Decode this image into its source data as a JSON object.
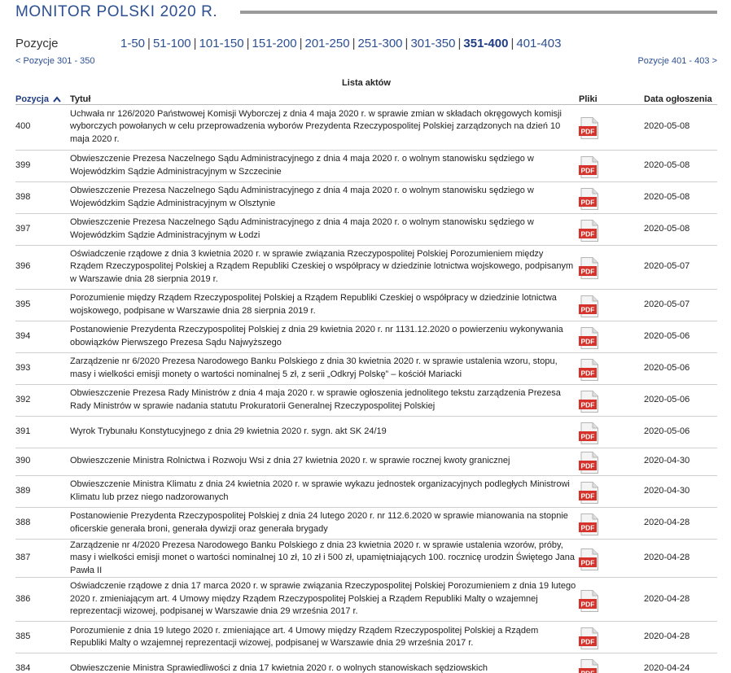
{
  "header": {
    "title": "MONITOR POLSKI 2020 R."
  },
  "pagination": {
    "label": "Pozycje",
    "pages": [
      {
        "label": "1-50",
        "current": false
      },
      {
        "label": "51-100",
        "current": false
      },
      {
        "label": "101-150",
        "current": false
      },
      {
        "label": "151-200",
        "current": false
      },
      {
        "label": "201-250",
        "current": false
      },
      {
        "label": "251-300",
        "current": false
      },
      {
        "label": "301-350",
        "current": false
      },
      {
        "label": "351-400",
        "current": true
      },
      {
        "label": "401-403",
        "current": false
      }
    ],
    "prev": "< Pozycje 301 - 350",
    "next": "Pozycje 401 - 403 >"
  },
  "table": {
    "caption": "Lista aktów",
    "columns": {
      "position": "Pozycja",
      "title": "Tytuł",
      "files": "Pliki",
      "date": "Data ogłoszenia"
    },
    "file_icon": "pdf-icon",
    "file_label": "PDF",
    "rows": [
      {
        "num": "400",
        "title": "Uchwała nr 126/2020 Państwowej Komisji Wyborczej z dnia 4 maja 2020 r. w sprawie zmian w składach okręgowych komisji wyborczych powołanych w celu przeprowadzenia wyborów Prezydenta Rzeczypospolitej Polskiej zarządzonych na dzień 10 maja 2020 r.",
        "date": "2020-05-08"
      },
      {
        "num": "399",
        "title": "Obwieszczenie Prezesa Naczelnego Sądu Administracyjnego z dnia 4 maja 2020 r. o wolnym stanowisku sędziego w Wojewódzkim Sądzie Administracyjnym w Szczecinie",
        "date": "2020-05-08"
      },
      {
        "num": "398",
        "title": "Obwieszczenie Prezesa Naczelnego Sądu Administracyjnego z dnia 4 maja 2020 r. o wolnym stanowisku sędziego w Wojewódzkim Sądzie Administracyjnym w Olsztynie",
        "date": "2020-05-08"
      },
      {
        "num": "397",
        "title": "Obwieszczenie Prezesa Naczelnego Sądu Administracyjnego z dnia 4 maja 2020 r. o wolnym stanowisku sędziego w Wojewódzkim Sądzie Administracyjnym w Łodzi",
        "date": "2020-05-08"
      },
      {
        "num": "396",
        "title": "Oświadczenie rządowe z dnia 3 kwietnia 2020 r. w sprawie związania Rzeczypospolitej Polskiej Porozumieniem między Rządem Rzeczypospolitej Polskiej a Rządem Republiki Czeskiej o współpracy w dziedzinie lotnictwa wojskowego, podpisanym w Warszawie dnia 28 sierpnia 2019 r.",
        "date": "2020-05-07"
      },
      {
        "num": "395",
        "title": "Porozumienie między Rządem Rzeczypospolitej Polskiej a Rządem Republiki Czeskiej o współpracy w dziedzinie lotnictwa wojskowego, podpisane w Warszawie dnia 28 sierpnia 2019 r.",
        "date": "2020-05-07"
      },
      {
        "num": "394",
        "title": "Postanowienie Prezydenta Rzeczypospolitej Polskiej z dnia 29 kwietnia 2020 r. nr 1131.12.2020 o powierzeniu wykonywania obowiązków Pierwszego Prezesa Sądu Najwyższego",
        "date": "2020-05-06"
      },
      {
        "num": "393",
        "title": "Zarządzenie nr 6/2020 Prezesa Narodowego Banku Polskiego z dnia 30 kwietnia 2020 r. w sprawie ustalenia wzoru, stopu, masy i wielkości emisji monety o wartości nominalnej 5 zł, z serii „Odkryj Polskę” – kościół Mariacki",
        "date": "2020-05-06"
      },
      {
        "num": "392",
        "title": "Obwieszczenie Prezesa Rady Ministrów z dnia 4 maja 2020 r. w sprawie ogłoszenia jednolitego tekstu zarządzenia Prezesa Rady Ministrów w sprawie nadania statutu Prokuratorii Generalnej Rzeczypospolitej Polskiej",
        "date": "2020-05-06"
      },
      {
        "num": "391",
        "title": "Wyrok Trybunału Konstytucyjnego z dnia 29 kwietnia 2020 r. sygn. akt SK 24/19",
        "date": "2020-05-06"
      },
      {
        "num": "390",
        "title": "Obwieszczenie Ministra Rolnictwa i Rozwoju Wsi z dnia 27 kwietnia 2020 r. w sprawie rocznej kwoty granicznej",
        "date": "2020-04-30"
      },
      {
        "num": "389",
        "title": "Obwieszczenie Ministra Klimatu z dnia 24 kwietnia 2020 r. w sprawie wykazu jednostek organizacyjnych podległych Ministrowi Klimatu lub przez niego nadzorowanych",
        "date": "2020-04-30"
      },
      {
        "num": "388",
        "title": "Postanowienie Prezydenta Rzeczypospolitej Polskiej z dnia 24 lutego 2020 r. nr 112.6.2020 w sprawie mianowania na stopnie oficerskie generała broni, generała dywizji oraz generała brygady",
        "date": "2020-04-28"
      },
      {
        "num": "387",
        "title": "Zarządzenie nr 4/2020 Prezesa Narodowego Banku Polskiego z dnia 23 kwietnia 2020 r. w sprawie ustalenia wzorów, próby, masy i wielkości emisji monet o wartości nominalnej 10 zł, 10 zł i 500 zł, upamiętniających 100. rocznicę urodzin Świętego Jana Pawła II",
        "date": "2020-04-28"
      },
      {
        "num": "386",
        "title": "Oświadczenie rządowe z dnia 17 marca 2020 r. w sprawie związania Rzeczypospolitej Polskiej Porozumieniem z dnia 19 lutego 2020 r. zmieniającym art. 4 Umowy między Rządem Rzeczypospolitej Polskiej a Rządem Republiki Malty o wzajemnej reprezentacji wizowej, podpisanej w Warszawie dnia 29 września 2017 r.",
        "date": "2020-04-28"
      },
      {
        "num": "385",
        "title": "Porozumienie z dnia 19 lutego 2020 r. zmieniające art. 4 Umowy między Rządem Rzeczypospolitej Polskiej a Rządem Republiki Malty o wzajemnej reprezentacji wizowej, podpisanej w Warszawie dnia 29 września 2017 r.",
        "date": "2020-04-28"
      },
      {
        "num": "384",
        "title": "Obwieszczenie Ministra Sprawiedliwości z dnia 17 kwietnia 2020 r. o wolnych stanowiskach sędziowskich",
        "date": "2020-04-24"
      }
    ]
  }
}
